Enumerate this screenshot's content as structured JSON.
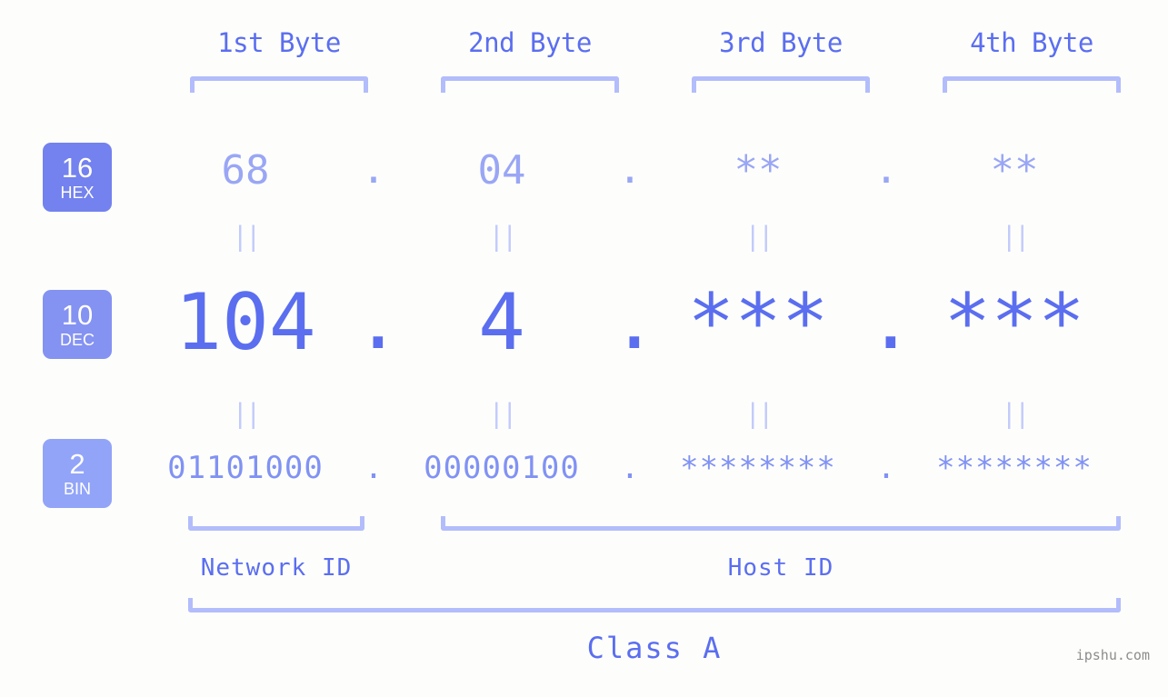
{
  "watermark": "ipshu.com",
  "columns": [
    {
      "header": "1st Byte"
    },
    {
      "header": "2nd Byte"
    },
    {
      "header": "3rd Byte"
    },
    {
      "header": "4th Byte"
    }
  ],
  "bases": [
    {
      "num": "16",
      "name": "HEX",
      "color": "#7382ee"
    },
    {
      "num": "10",
      "name": "DEC",
      "color": "#8492f2"
    },
    {
      "num": "2",
      "name": "BIN",
      "color": "#92a4f8"
    }
  ],
  "rows": {
    "hex": {
      "values": [
        "68",
        "04",
        "**",
        "**"
      ],
      "separator": "."
    },
    "dec": {
      "values": [
        "104",
        "4",
        "***",
        "***"
      ],
      "separator": "."
    },
    "bin": {
      "values": [
        "01101000",
        "00000100",
        "********",
        "********"
      ],
      "separator": "."
    }
  },
  "equals_symbol": "||",
  "segments": {
    "network": "Network ID",
    "host": "Host ID"
  },
  "class_label": "Class A",
  "colors": {
    "background": "#fdfefb",
    "accent": "#5b6ef0",
    "accent_light": "#9aa6f5",
    "bracket": "#b3bdfb",
    "equals": "#c3cbfc",
    "watermark": "#8c8c8c"
  }
}
